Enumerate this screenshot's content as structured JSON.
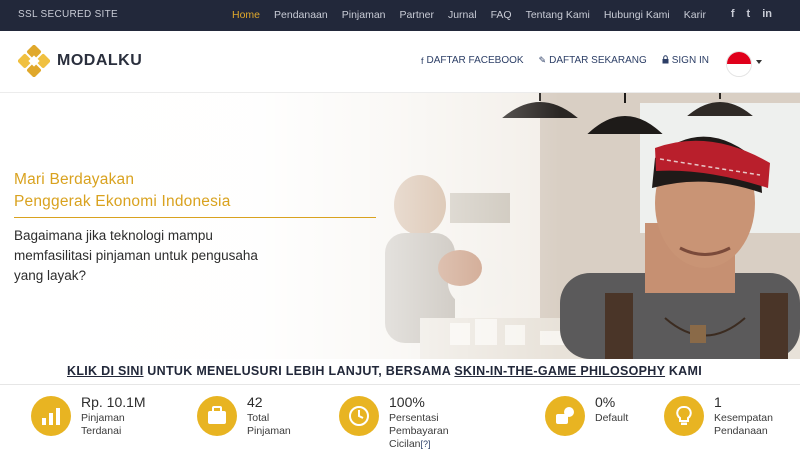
{
  "topbar": {
    "ssl": "SSL SECURED SITE",
    "nav": [
      "Home",
      "Pendanaan",
      "Pinjaman",
      "Partner",
      "Jurnal",
      "FAQ",
      "Tentang Kami",
      "Hubungi Kami",
      "Karir"
    ],
    "active": "Home",
    "social": [
      "f",
      "t",
      "in"
    ]
  },
  "header": {
    "logo_text": "MODALKU",
    "facebook": "DAFTAR FACEBOOK",
    "register": "DAFTAR SEKARANG",
    "signin": "SIGN IN"
  },
  "hero": {
    "headline_1": "Mari Berdayakan",
    "headline_2": "Penggerak Ekonomi Indonesia",
    "subtext": "Bagaimana jika teknologi mampu memfasilitasi pinjaman untuk pengusaha yang layak?",
    "accent_color": "#d9a21f"
  },
  "cta": {
    "link_1": "KLIK DI SINI",
    "text_1": " UNTUK MENELUSURI LEBIH LANJUT, BERSAMA ",
    "link_2": "SKIN-IN-THE-GAME PHILOSOPHY",
    "text_2": " KAMI"
  },
  "stats": [
    {
      "icon": "bar-chart-icon",
      "value": "Rp. 10.1M",
      "label": "Pinjaman\nTerdanai"
    },
    {
      "icon": "briefcase-icon",
      "value": "42",
      "label": "Total\nPinjaman"
    },
    {
      "icon": "clock-icon",
      "value": "100%",
      "label": "Persentasi Pembayaran\nCicilan"
    },
    {
      "icon": "coins-icon",
      "value": "0%",
      "label": "Default"
    },
    {
      "icon": "lightbulb-icon",
      "value": "1",
      "label": "Kesempatan\nPendanaan"
    }
  ],
  "stats_help": "[?]",
  "colors": {
    "topbar": "#22283a",
    "gold": "#e8b422",
    "navy": "#2c3e66"
  }
}
